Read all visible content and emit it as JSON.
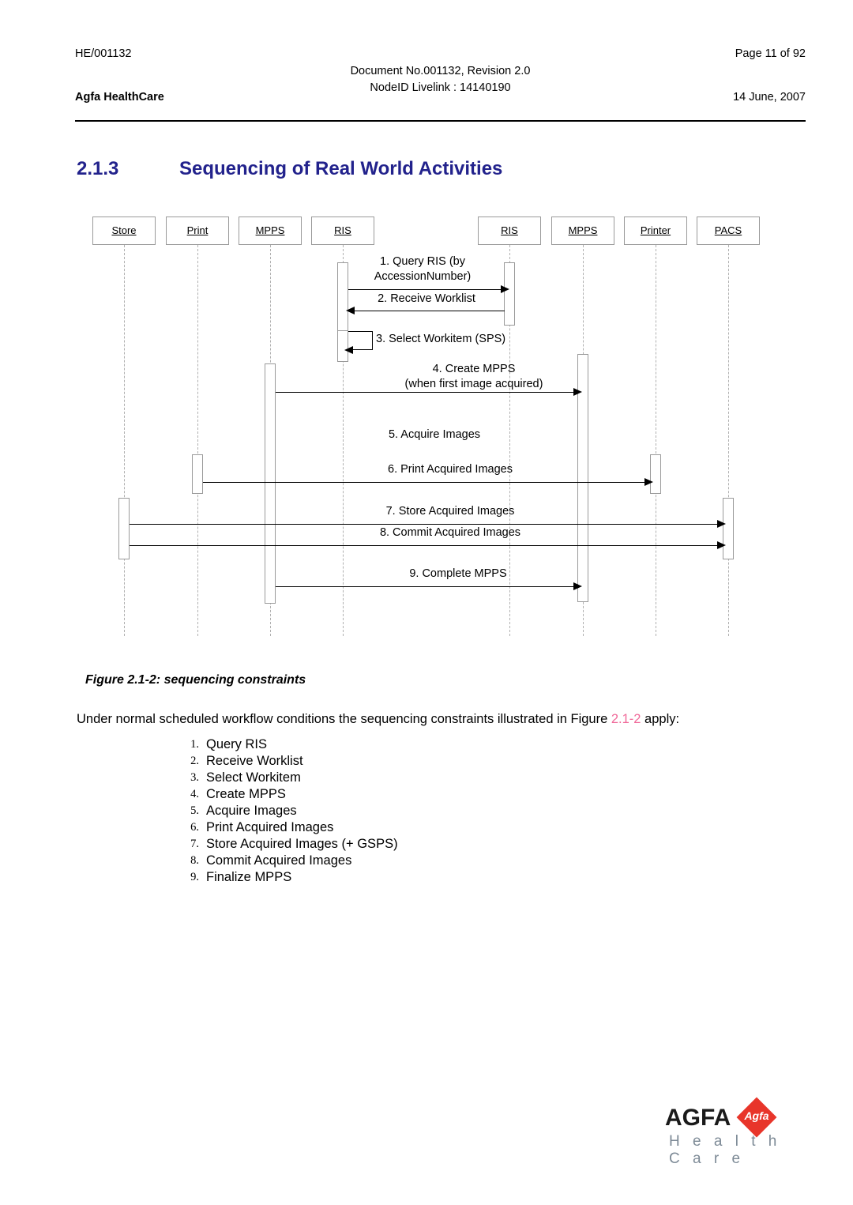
{
  "header": {
    "doc_code": "HE/001132",
    "page_label": "Page 11 of 92",
    "center_line1": "Document No.001132, Revision 2.0",
    "center_line2": "NodeID Livelink : 14140190",
    "company": "Agfa HealthCare",
    "date": "14 June, 2007"
  },
  "section": {
    "number": "2.1.3",
    "title": "Sequencing of Real World Activities",
    "color": "#22228c"
  },
  "diagram": {
    "lifelines": [
      {
        "id": "store",
        "label": "Store"
      },
      {
        "id": "print",
        "label": "Print"
      },
      {
        "id": "mpps-left",
        "label": "MPPS"
      },
      {
        "id": "ris-left",
        "label": "RIS"
      },
      {
        "id": "ris-right",
        "label": "RIS"
      },
      {
        "id": "mpps-right",
        "label": "MPPS"
      },
      {
        "id": "printer",
        "label": "Printer"
      },
      {
        "id": "pacs",
        "label": "PACS"
      }
    ],
    "messages": [
      {
        "n": "1",
        "label": "1. Query RIS (by\nAccessionNumber)",
        "from": "ris-left",
        "to": "ris-right",
        "direction": "right"
      },
      {
        "n": "2",
        "label": "2. Receive Worklist",
        "from": "ris-right",
        "to": "ris-left",
        "direction": "left"
      },
      {
        "n": "3",
        "label": "3. Select Workitem (SPS)",
        "from": "ris-left",
        "to": "ris-left",
        "direction": "self"
      },
      {
        "n": "4",
        "label": "4. Create MPPS\n(when first image acquired)",
        "from": "mpps-left",
        "to": "mpps-right",
        "direction": "right"
      },
      {
        "n": "5",
        "label": "5. Acquire Images",
        "from": "",
        "to": "",
        "direction": "none"
      },
      {
        "n": "6",
        "label": "6. Print Acquired Images",
        "from": "print",
        "to": "printer",
        "direction": "right"
      },
      {
        "n": "7",
        "label": "7. Store Acquired Images",
        "from": "store",
        "to": "pacs",
        "direction": "right"
      },
      {
        "n": "8",
        "label": "8. Commit Acquired Images",
        "from": "store",
        "to": "pacs",
        "direction": "right"
      },
      {
        "n": "9",
        "label": "9. Complete MPPS",
        "from": "mpps-left",
        "to": "mpps-right",
        "direction": "right"
      }
    ]
  },
  "figure_caption": "Figure 2.1-2: sequencing constraints",
  "body": {
    "para_before": "Under normal scheduled workflow conditions the sequencing constraints illustrated in Figure ",
    "figure_ref": "2.1-2",
    "para_after": " apply:",
    "figure_ref_color": "#f06a9a"
  },
  "steps": [
    {
      "num": "1.",
      "text": "Query RIS"
    },
    {
      "num": "2.",
      "text": "Receive Worklist"
    },
    {
      "num": "3.",
      "text": "Select Workitem"
    },
    {
      "num": "4.",
      "text": "Create MPPS"
    },
    {
      "num": "5.",
      "text": "Acquire Images"
    },
    {
      "num": "6.",
      "text": "Print Acquired Images"
    },
    {
      "num": "7.",
      "text": "Store Acquired Images (+ GSPS)"
    },
    {
      "num": "8.",
      "text": "Commit Acquired Images"
    },
    {
      "num": "9.",
      "text": "Finalize MPPS"
    }
  ],
  "logo": {
    "wordmark": "AGFA",
    "diamond_text": "Agfa",
    "subtitle": "H e a l t h C a r e",
    "diamond_color": "#e8352a",
    "subtitle_color": "#7d8a96"
  }
}
